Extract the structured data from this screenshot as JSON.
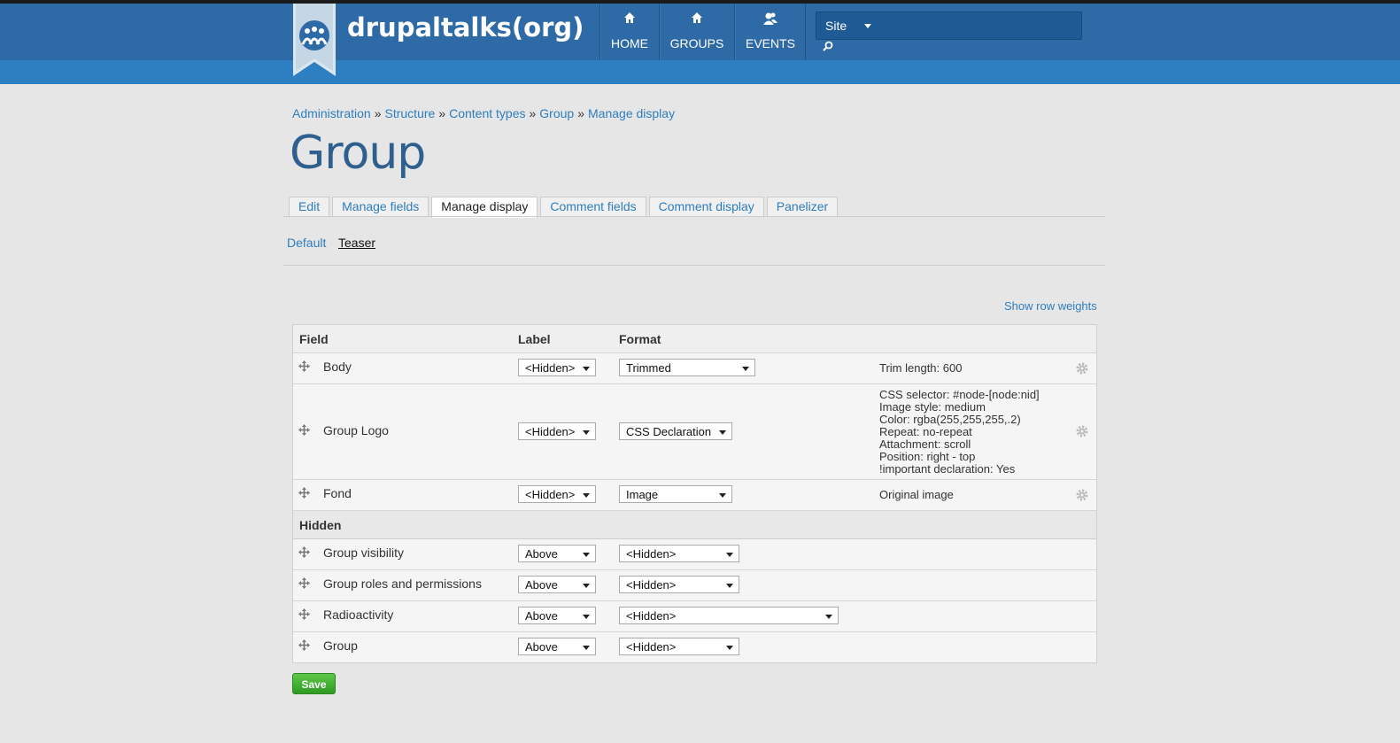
{
  "site": {
    "name": "drupaltalks(org)",
    "nav": [
      {
        "label": "HOME",
        "icon": "home-icon"
      },
      {
        "label": "GROUPS",
        "icon": "groups-icon"
      },
      {
        "label": "EVENTS",
        "icon": "events-icon"
      }
    ],
    "search": {
      "scope": "Site",
      "icon": "search-icon"
    }
  },
  "colors": {
    "header": "#2e6aa6",
    "subbar": "#2d7fc1",
    "link": "#2e7dbd",
    "title": "#2e5f8f",
    "save": "#3aa52a"
  },
  "breadcrumb": [
    "Administration",
    "Structure",
    "Content types",
    "Group",
    "Manage display"
  ],
  "breadcrumb_separator": "»",
  "page_title": "Group",
  "tabs": [
    {
      "label": "Edit",
      "active": false
    },
    {
      "label": "Manage fields",
      "active": false
    },
    {
      "label": "Manage display",
      "active": true
    },
    {
      "label": "Comment fields",
      "active": false
    },
    {
      "label": "Comment display",
      "active": false
    },
    {
      "label": "Panelizer",
      "active": false
    }
  ],
  "subtabs": [
    {
      "label": "Default",
      "active": false
    },
    {
      "label": "Teaser",
      "active": true
    }
  ],
  "show_row_weights": "Show row weights",
  "table": {
    "headers": {
      "field": "Field",
      "label": "Label",
      "format": "Format"
    },
    "rows": [
      {
        "name": "Body",
        "label": "<Hidden>",
        "format": "Trimmed",
        "summary": [
          "Trim length: 600"
        ],
        "gear": true
      },
      {
        "name": "Group Logo",
        "label": "<Hidden>",
        "format": "CSS Declaration",
        "summary": [
          "CSS selector: #node-[node:nid]",
          "Image style: medium",
          "Color: rgba(255,255,255,.2)",
          "Repeat: no-repeat",
          "Attachment: scroll",
          "Position: right - top",
          "!important declaration: Yes"
        ],
        "gear": true
      },
      {
        "name": "Fond",
        "label": "<Hidden>",
        "format": "Image",
        "summary": [
          "Original image"
        ],
        "gear": true
      }
    ],
    "hidden_region": "Hidden",
    "hidden_rows": [
      {
        "name": "Group visibility",
        "label": "Above",
        "format": "<Hidden>"
      },
      {
        "name": "Group roles and permissions",
        "label": "Above",
        "format": "<Hidden>"
      },
      {
        "name": "Radioactivity",
        "label": "Above",
        "format": "<Hidden>"
      },
      {
        "name": "Group",
        "label": "Above",
        "format": "<Hidden>"
      }
    ]
  },
  "save_label": "Save"
}
